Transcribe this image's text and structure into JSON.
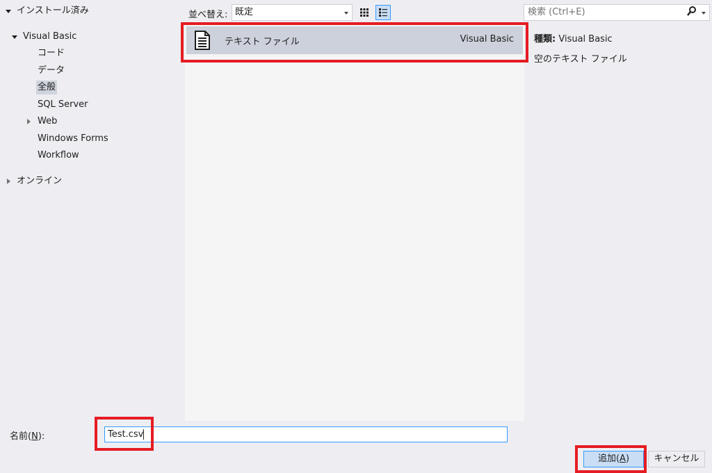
{
  "tree": {
    "installed": {
      "label": "インストール済み"
    },
    "visual_basic": {
      "label": "Visual Basic"
    },
    "children": [
      {
        "label": "コード"
      },
      {
        "label": "データ"
      },
      {
        "label": "全般"
      },
      {
        "label": "SQL Server"
      },
      {
        "label": "Web"
      },
      {
        "label": "Windows Forms"
      },
      {
        "label": "Workflow"
      }
    ],
    "online": {
      "label": "オンライン"
    }
  },
  "toolbar": {
    "sort_label": "並べ替え:",
    "sort_value": "既定",
    "search_placeholder": "検索 (Ctrl+E)"
  },
  "templates": [
    {
      "name": "テキスト ファイル",
      "type": "Visual Basic"
    }
  ],
  "details": {
    "type_label": "種類:",
    "type_value": "Visual Basic",
    "description": "空のテキスト ファイル"
  },
  "name_field": {
    "label_prefix": "名前(",
    "label_accel": "N",
    "label_suffix": "):",
    "value": "Test.csv"
  },
  "buttons": {
    "add_prefix": "追加(",
    "add_accel": "A",
    "add_suffix": ")",
    "cancel": "キャンセル"
  },
  "colors": {
    "accent": "#3399ff",
    "highlight": "#e51c23",
    "selected_item": "#cdd1db"
  }
}
